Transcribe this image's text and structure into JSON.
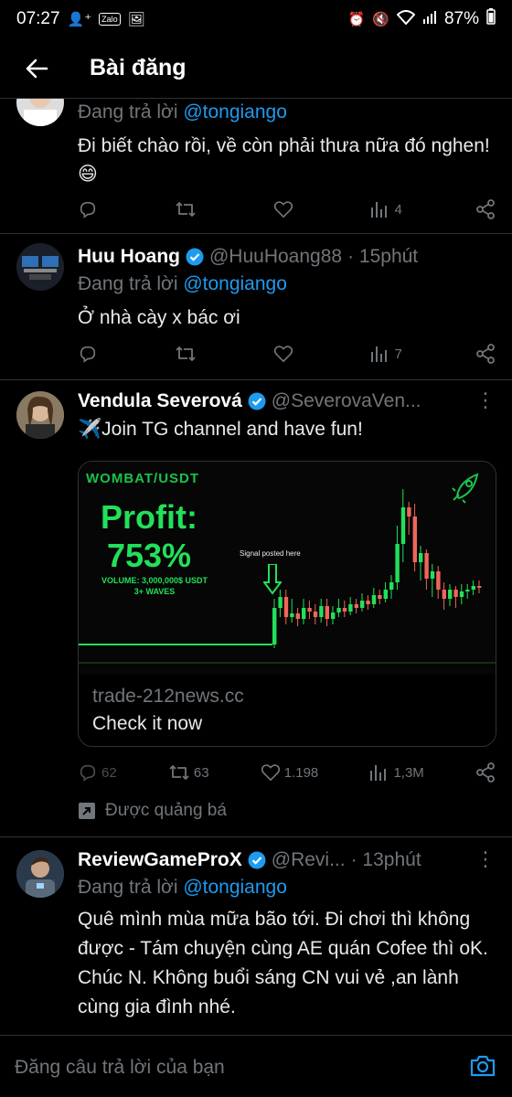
{
  "status_bar": {
    "time": "07:27",
    "zalo": "Zalo",
    "battery": "87%"
  },
  "header": {
    "title": "Bài đăng"
  },
  "posts": [
    {
      "reply_prefix": "Đang trả lời ",
      "reply_handle": "@tongiango",
      "text": "Đi biết chào rồi, về còn phải thưa nữa đó nghen! 😄",
      "stats": {
        "comments": "",
        "retweets": "",
        "likes": "",
        "views": "4"
      }
    },
    {
      "name": "Huu Hoang",
      "handle": "@HuuHoang88",
      "time": "· 15phút",
      "reply_prefix": "Đang trả lời ",
      "reply_handle": "@tongiango",
      "text": "Ở nhà cày x bác ơi",
      "stats": {
        "comments": "",
        "retweets": "",
        "likes": "",
        "views": "7"
      }
    },
    {
      "name": "Vendula Severová",
      "handle": "@SeverovaVen...",
      "text": "✈️Join TG channel and have fun!",
      "card": {
        "pair": "WOMBAT/USDT",
        "profit_label": "Profit:",
        "profit_value": "753%",
        "volume": "VOLUME: 3,000,000$ USDT",
        "waves": "3+ WAVES",
        "signal": "Signal posted here",
        "domain": "trade-212news.cc",
        "cta": "Check it now"
      },
      "stats": {
        "comments": "62",
        "retweets": "63",
        "likes": "1.198",
        "views": "1,3M"
      },
      "promoted": "Được quảng bá"
    },
    {
      "name": "ReviewGameProX",
      "handle": "@Revi...",
      "time": "· 13phút",
      "reply_prefix": "Đang trả lời ",
      "reply_handle": "@tongiango",
      "text": "Quê mình mùa mữa bão tới. Đi chơi thì không được - Tám chuyện cùng AE quán Cofee thì oK. Chúc N. Không buổi sáng CN vui vẻ ,an lành cùng gia đình nhé."
    }
  ],
  "composer": {
    "placeholder": "Đăng câu trả lời của bạn"
  },
  "colors": {
    "accent": "#1d9bf0",
    "muted": "#71767b",
    "chart_green": "#22e05a",
    "chart_red": "#f0655a"
  }
}
